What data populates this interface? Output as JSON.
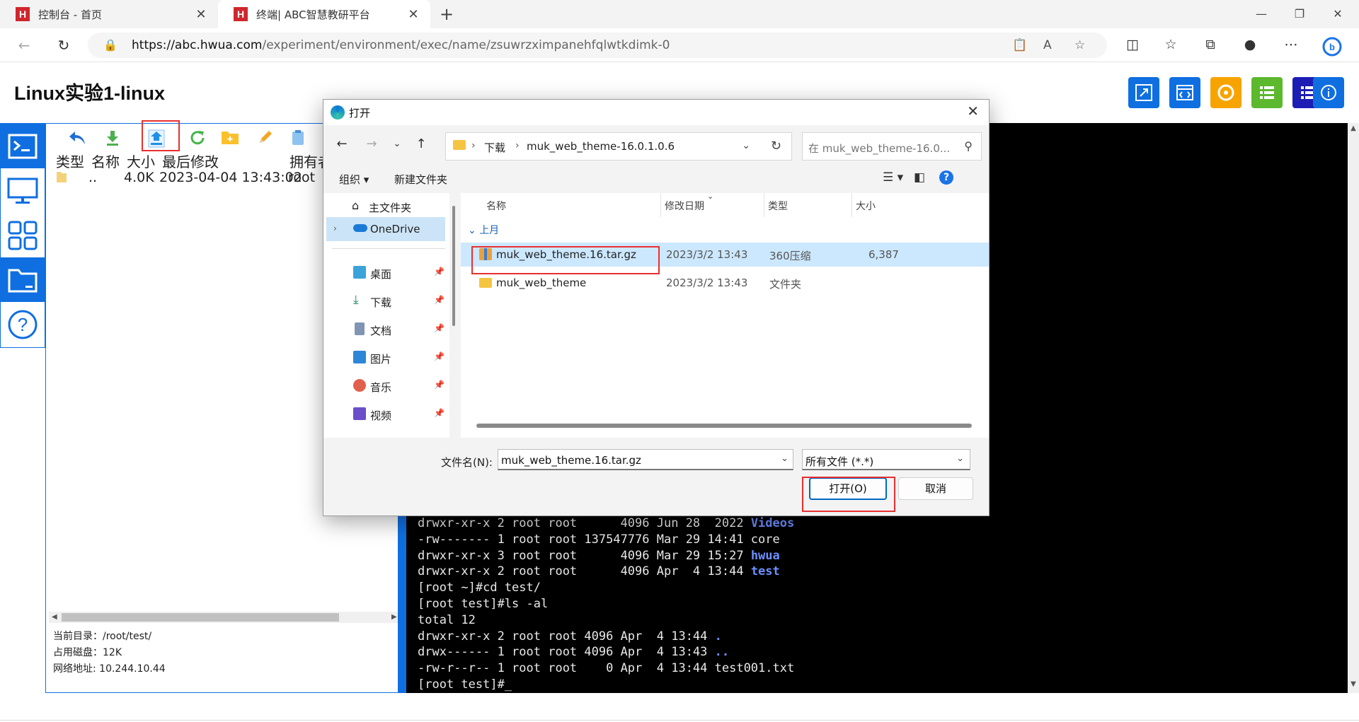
{
  "browser": {
    "tabs": [
      {
        "title": "控制台 - 首页",
        "close": "✕"
      },
      {
        "title": "终端| ABC智慧教研平台",
        "close": "✕"
      }
    ],
    "favicon_letter": "H",
    "new_tab": "+",
    "url_host": "https://abc.hwua.com",
    "url_path": "/experiment/environment/exec/name/zsuwrzximpanehfqlwtkdimk-0"
  },
  "page": {
    "title": "Linux实验1-linux",
    "colors": {
      "primary": "#0f6fe0",
      "orange": "#f7a400",
      "green": "#5cb82d",
      "navy": "#1d1db6"
    }
  },
  "file_manager": {
    "toolbar_icons": [
      "back-arrow-icon",
      "download-icon",
      "upload-icon",
      "refresh-icon",
      "new-folder-icon",
      "edit-icon",
      "paste-icon"
    ],
    "headers": {
      "type": "类型",
      "name": "名称",
      "size": "大小",
      "modified": "最后修改",
      "owner": "拥有者"
    },
    "rows": [
      {
        "name": "..",
        "size": "4.0K",
        "modified": "2023-04-04 13:43:02",
        "owner": "root"
      }
    ],
    "info": {
      "current_dir": "当前目录：/root/test/",
      "disk_used": "占用磁盘：12K",
      "network": "网络地址: 10.244.10.44"
    }
  },
  "terminal": {
    "lines": [
      {
        "text": "drwxr-xr-x 2 root root      4096 Jun 28  2022 ",
        "dir": "Videos"
      },
      {
        "text": "-rw------- 1 root root 137547776 Mar 29 14:41 core",
        "dir": ""
      },
      {
        "text": "drwxr-xr-x 3 root root      4096 Mar 29 15:27 ",
        "dir": "hwua"
      },
      {
        "text": "drwxr-xr-x 2 root root      4096 Apr  4 13:44 ",
        "dir": "test"
      },
      {
        "text": "[root ~]#cd test/",
        "dir": ""
      },
      {
        "text": "[root test]#ls -al",
        "dir": ""
      },
      {
        "text": "total 12",
        "dir": ""
      },
      {
        "text": "drwxr-xr-x 2 root root 4096 Apr  4 13:44 ",
        "dir": "."
      },
      {
        "text": "drwx------ 1 root root 4096 Apr  4 13:43 ",
        "dir": ".."
      },
      {
        "text": "-rw-r--r-- 1 root root    0 Apr  4 13:44 test001.txt",
        "dir": ""
      },
      {
        "text": "[root test]#_",
        "dir": ""
      }
    ]
  },
  "dialog": {
    "title": "打开",
    "close": "✕",
    "path": {
      "segment1": "下载",
      "segment2": "muk_web_theme-16.0.1.0.6"
    },
    "search_placeholder": "在 muk_web_theme-16.0...",
    "commands": {
      "organize": "组织 ▾",
      "new_folder": "新建文件夹"
    },
    "nav_items": [
      {
        "label": "主文件夹",
        "icon": "home-icon"
      },
      {
        "label": "OneDrive",
        "icon": "cloud-icon"
      },
      {
        "label": "桌面",
        "icon": "desktop-icon"
      },
      {
        "label": "下载",
        "icon": "download-icon"
      },
      {
        "label": "文档",
        "icon": "document-icon"
      },
      {
        "label": "图片",
        "icon": "picture-icon"
      },
      {
        "label": "音乐",
        "icon": "music-icon"
      },
      {
        "label": "视频",
        "icon": "video-icon"
      }
    ],
    "columns": {
      "name": "名称",
      "date": "修改日期",
      "type": "类型",
      "size": "大小"
    },
    "group": "上月",
    "files": [
      {
        "name": "muk_web_theme.16.tar.gz",
        "date": "2023/3/2 13:43",
        "type": "360压缩",
        "size": "6,387",
        "selected": true
      },
      {
        "name": "muk_web_theme",
        "date": "2023/3/2 13:43",
        "type": "文件夹",
        "size": "",
        "selected": false
      }
    ],
    "filename_label": "文件名(N):",
    "filename_value": "muk_web_theme.16.tar.gz",
    "filetype_value": "所有文件 (*.*)",
    "open_button": "打开(O)",
    "cancel_button": "取消"
  }
}
